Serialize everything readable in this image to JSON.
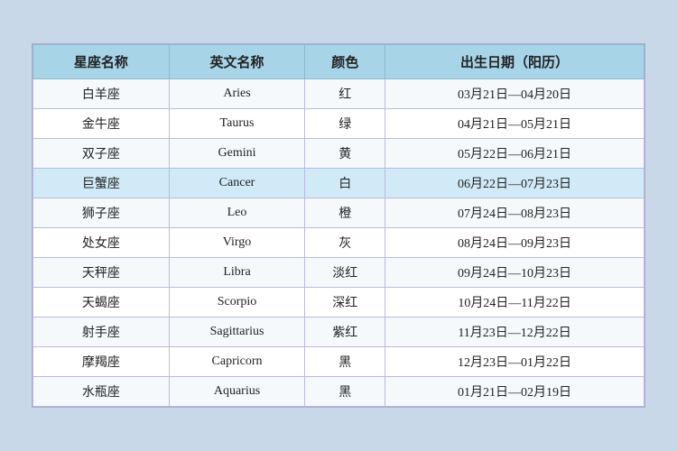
{
  "table": {
    "headers": [
      "星座名称",
      "英文名称",
      "颜色",
      "出生日期（阳历）"
    ],
    "rows": [
      {
        "chinese": "白羊座",
        "english": "Aries",
        "color": "红",
        "dates": "03月21日—04月20日"
      },
      {
        "chinese": "金牛座",
        "english": "Taurus",
        "color": "绿",
        "dates": "04月21日—05月21日"
      },
      {
        "chinese": "双子座",
        "english": "Gemini",
        "color": "黄",
        "dates": "05月22日—06月21日"
      },
      {
        "chinese": "巨蟹座",
        "english": "Cancer",
        "color": "白",
        "dates": "06月22日—07月23日",
        "highlight": true
      },
      {
        "chinese": "狮子座",
        "english": "Leo",
        "color": "橙",
        "dates": "07月24日—08月23日"
      },
      {
        "chinese": "处女座",
        "english": "Virgo",
        "color": "灰",
        "dates": "08月24日—09月23日"
      },
      {
        "chinese": "天秤座",
        "english": "Libra",
        "color": "淡红",
        "dates": "09月24日—10月23日"
      },
      {
        "chinese": "天蝎座",
        "english": "Scorpio",
        "color": "深红",
        "dates": "10月24日—11月22日"
      },
      {
        "chinese": "射手座",
        "english": "Sagittarius",
        "color": "紫红",
        "dates": "11月23日—12月22日"
      },
      {
        "chinese": "摩羯座",
        "english": "Capricorn",
        "color": "黑",
        "dates": "12月23日—01月22日"
      },
      {
        "chinese": "水瓶座",
        "english": "Aquarius",
        "color": "黑",
        "dates": "01月21日—02月19日"
      }
    ]
  }
}
